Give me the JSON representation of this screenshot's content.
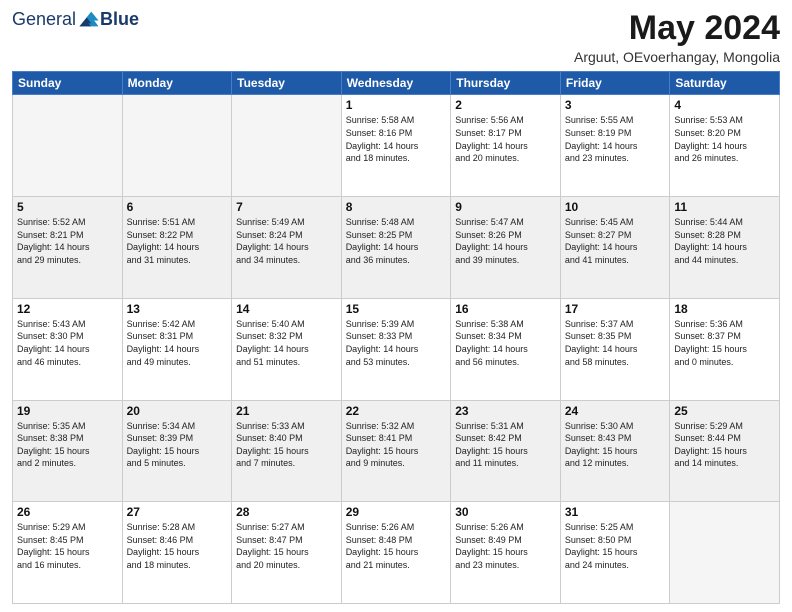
{
  "logo": {
    "general": "General",
    "blue": "Blue"
  },
  "title": "May 2024",
  "subtitle": "Arguut, OEvoerhangay, Mongolia",
  "days_of_week": [
    "Sunday",
    "Monday",
    "Tuesday",
    "Wednesday",
    "Thursday",
    "Friday",
    "Saturday"
  ],
  "weeks": [
    [
      {
        "day": "",
        "info": ""
      },
      {
        "day": "",
        "info": ""
      },
      {
        "day": "",
        "info": ""
      },
      {
        "day": "1",
        "info": "Sunrise: 5:58 AM\nSunset: 8:16 PM\nDaylight: 14 hours\nand 18 minutes."
      },
      {
        "day": "2",
        "info": "Sunrise: 5:56 AM\nSunset: 8:17 PM\nDaylight: 14 hours\nand 20 minutes."
      },
      {
        "day": "3",
        "info": "Sunrise: 5:55 AM\nSunset: 8:19 PM\nDaylight: 14 hours\nand 23 minutes."
      },
      {
        "day": "4",
        "info": "Sunrise: 5:53 AM\nSunset: 8:20 PM\nDaylight: 14 hours\nand 26 minutes."
      }
    ],
    [
      {
        "day": "5",
        "info": "Sunrise: 5:52 AM\nSunset: 8:21 PM\nDaylight: 14 hours\nand 29 minutes."
      },
      {
        "day": "6",
        "info": "Sunrise: 5:51 AM\nSunset: 8:22 PM\nDaylight: 14 hours\nand 31 minutes."
      },
      {
        "day": "7",
        "info": "Sunrise: 5:49 AM\nSunset: 8:24 PM\nDaylight: 14 hours\nand 34 minutes."
      },
      {
        "day": "8",
        "info": "Sunrise: 5:48 AM\nSunset: 8:25 PM\nDaylight: 14 hours\nand 36 minutes."
      },
      {
        "day": "9",
        "info": "Sunrise: 5:47 AM\nSunset: 8:26 PM\nDaylight: 14 hours\nand 39 minutes."
      },
      {
        "day": "10",
        "info": "Sunrise: 5:45 AM\nSunset: 8:27 PM\nDaylight: 14 hours\nand 41 minutes."
      },
      {
        "day": "11",
        "info": "Sunrise: 5:44 AM\nSunset: 8:28 PM\nDaylight: 14 hours\nand 44 minutes."
      }
    ],
    [
      {
        "day": "12",
        "info": "Sunrise: 5:43 AM\nSunset: 8:30 PM\nDaylight: 14 hours\nand 46 minutes."
      },
      {
        "day": "13",
        "info": "Sunrise: 5:42 AM\nSunset: 8:31 PM\nDaylight: 14 hours\nand 49 minutes."
      },
      {
        "day": "14",
        "info": "Sunrise: 5:40 AM\nSunset: 8:32 PM\nDaylight: 14 hours\nand 51 minutes."
      },
      {
        "day": "15",
        "info": "Sunrise: 5:39 AM\nSunset: 8:33 PM\nDaylight: 14 hours\nand 53 minutes."
      },
      {
        "day": "16",
        "info": "Sunrise: 5:38 AM\nSunset: 8:34 PM\nDaylight: 14 hours\nand 56 minutes."
      },
      {
        "day": "17",
        "info": "Sunrise: 5:37 AM\nSunset: 8:35 PM\nDaylight: 14 hours\nand 58 minutes."
      },
      {
        "day": "18",
        "info": "Sunrise: 5:36 AM\nSunset: 8:37 PM\nDaylight: 15 hours\nand 0 minutes."
      }
    ],
    [
      {
        "day": "19",
        "info": "Sunrise: 5:35 AM\nSunset: 8:38 PM\nDaylight: 15 hours\nand 2 minutes."
      },
      {
        "day": "20",
        "info": "Sunrise: 5:34 AM\nSunset: 8:39 PM\nDaylight: 15 hours\nand 5 minutes."
      },
      {
        "day": "21",
        "info": "Sunrise: 5:33 AM\nSunset: 8:40 PM\nDaylight: 15 hours\nand 7 minutes."
      },
      {
        "day": "22",
        "info": "Sunrise: 5:32 AM\nSunset: 8:41 PM\nDaylight: 15 hours\nand 9 minutes."
      },
      {
        "day": "23",
        "info": "Sunrise: 5:31 AM\nSunset: 8:42 PM\nDaylight: 15 hours\nand 11 minutes."
      },
      {
        "day": "24",
        "info": "Sunrise: 5:30 AM\nSunset: 8:43 PM\nDaylight: 15 hours\nand 12 minutes."
      },
      {
        "day": "25",
        "info": "Sunrise: 5:29 AM\nSunset: 8:44 PM\nDaylight: 15 hours\nand 14 minutes."
      }
    ],
    [
      {
        "day": "26",
        "info": "Sunrise: 5:29 AM\nSunset: 8:45 PM\nDaylight: 15 hours\nand 16 minutes."
      },
      {
        "day": "27",
        "info": "Sunrise: 5:28 AM\nSunset: 8:46 PM\nDaylight: 15 hours\nand 18 minutes."
      },
      {
        "day": "28",
        "info": "Sunrise: 5:27 AM\nSunset: 8:47 PM\nDaylight: 15 hours\nand 20 minutes."
      },
      {
        "day": "29",
        "info": "Sunrise: 5:26 AM\nSunset: 8:48 PM\nDaylight: 15 hours\nand 21 minutes."
      },
      {
        "day": "30",
        "info": "Sunrise: 5:26 AM\nSunset: 8:49 PM\nDaylight: 15 hours\nand 23 minutes."
      },
      {
        "day": "31",
        "info": "Sunrise: 5:25 AM\nSunset: 8:50 PM\nDaylight: 15 hours\nand 24 minutes."
      },
      {
        "day": "",
        "info": ""
      }
    ]
  ]
}
